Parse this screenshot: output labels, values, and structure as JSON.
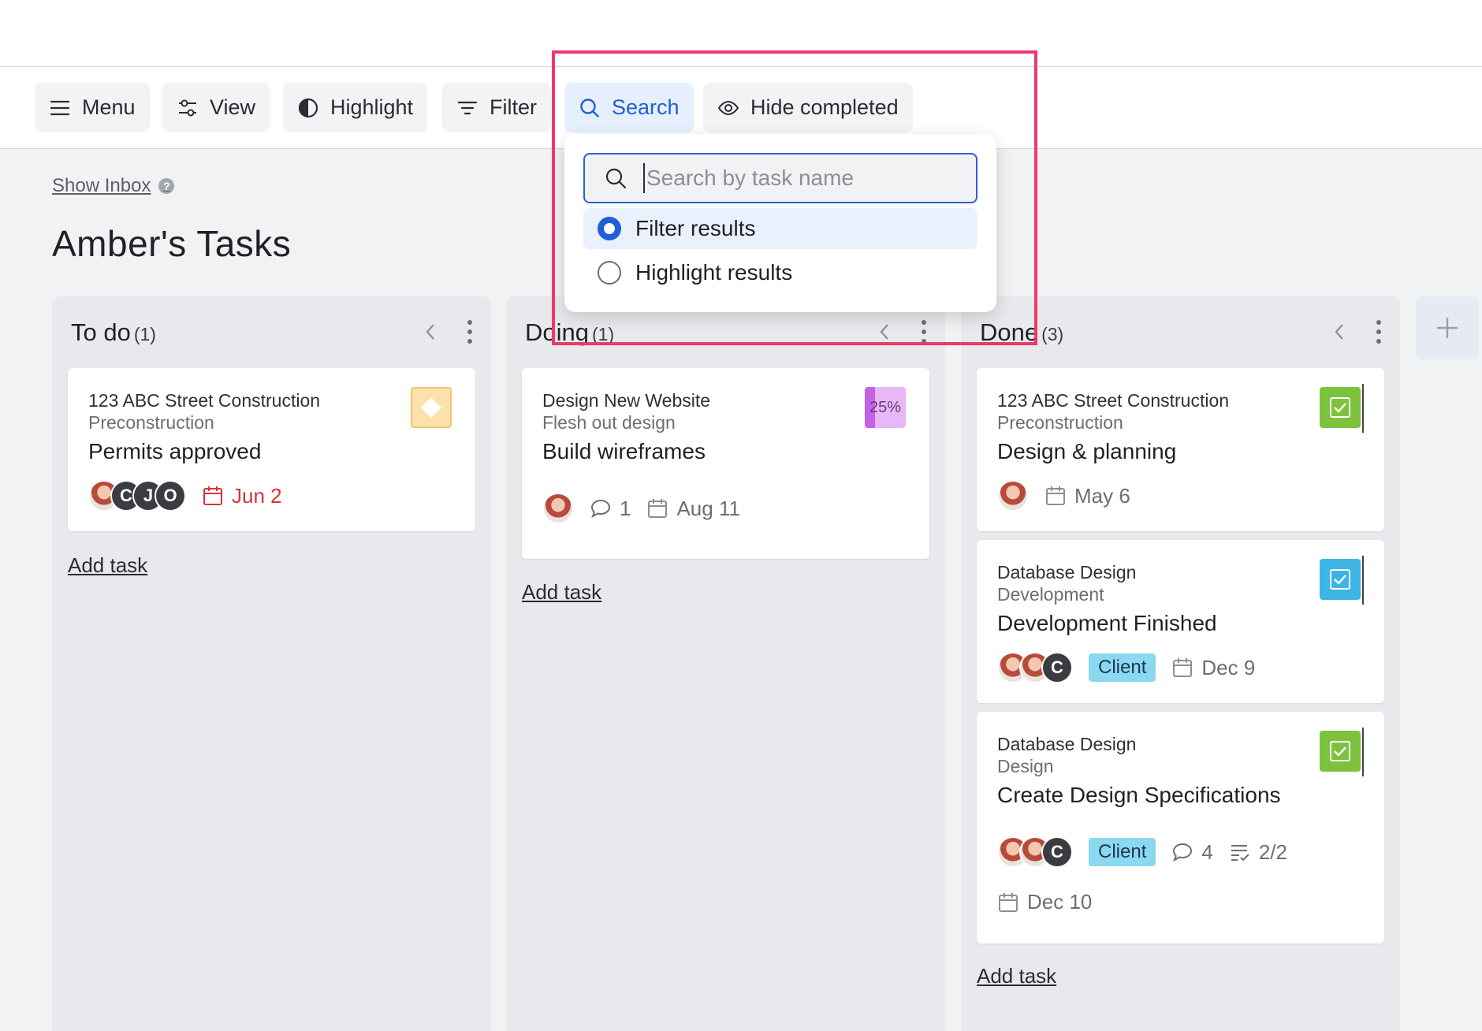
{
  "toolbar": {
    "menu_label": "Menu",
    "view_label": "View",
    "highlight_label": "Highlight",
    "filter_label": "Filter",
    "search_label": "Search",
    "hide_completed_label": "Hide completed"
  },
  "page": {
    "show_inbox": "Show Inbox",
    "title": "Amber's Tasks"
  },
  "search_popover": {
    "placeholder": "Search by task name",
    "options": [
      {
        "label": "Filter results",
        "selected": true
      },
      {
        "label": "Highlight results",
        "selected": false
      }
    ]
  },
  "columns": [
    {
      "title": "To do",
      "count": "(1)",
      "add_task": "Add task",
      "cards": [
        {
          "project": "123 ABC Street Construction",
          "phase": "Preconstruction",
          "name": "Permits approved",
          "avatar_letters": [
            "C",
            "J",
            "O"
          ],
          "due": "Jun 2",
          "badge": "milestone-diamond"
        }
      ]
    },
    {
      "title": "Doing",
      "count": "(1)",
      "add_task": "Add task",
      "cards": [
        {
          "project": "Design New Website",
          "phase": "Flesh out design",
          "name": "Build wireframes",
          "progress": "25%",
          "comments": "1",
          "due": "Aug 11"
        }
      ]
    },
    {
      "title": "Done",
      "count": "(3)",
      "add_task": "Add task",
      "cards": [
        {
          "project": "123 ABC Street Construction",
          "phase": "Preconstruction",
          "name": "Design & planning",
          "due": "May 6",
          "badge_color": "#7cc23d"
        },
        {
          "project": "Database Design",
          "phase": "Development",
          "name": "Development Finished",
          "avatar_letters": [
            "C"
          ],
          "tag": "Client",
          "due": "Dec 9",
          "badge_color": "#3cb4e4"
        },
        {
          "project": "Database Design",
          "phase": "Design",
          "name": "Create Design Specifications",
          "avatar_letters": [
            "C"
          ],
          "tag": "Client",
          "comments": "4",
          "checklist": "2/2",
          "due": "Dec 10",
          "badge_color": "#7cc23d"
        }
      ]
    }
  ],
  "colors": {
    "accent": "#1f5fd6",
    "overdue": "#d2353b",
    "annotation_box": "#f0386b"
  }
}
